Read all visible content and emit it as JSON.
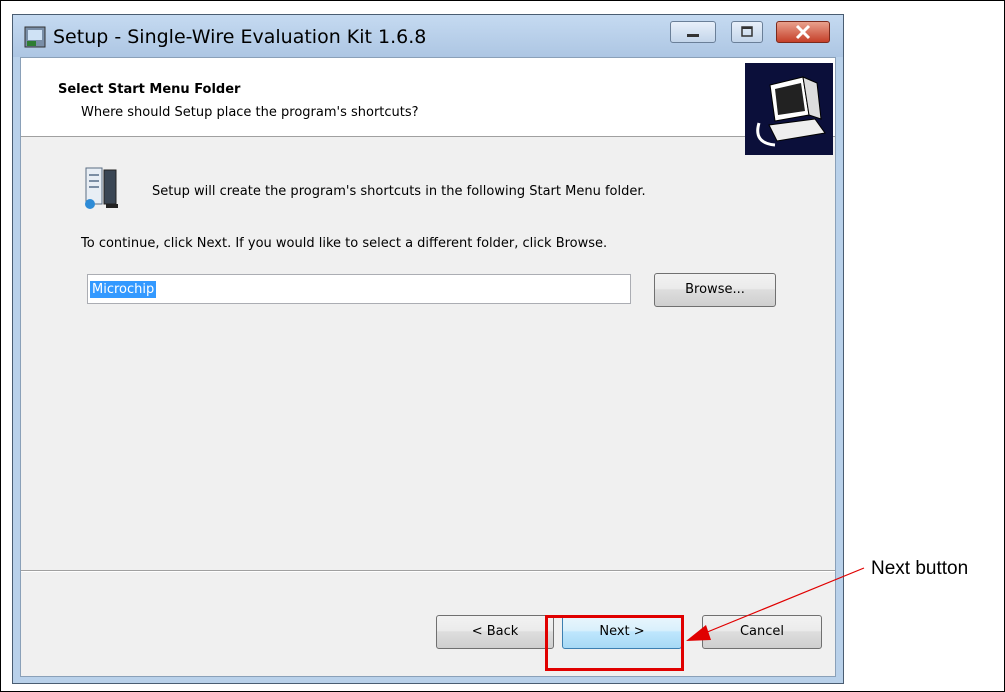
{
  "window": {
    "title": "Setup - Single-Wire Evaluation Kit 1.6.8",
    "buttons": {
      "minimize_icon": "minimize-icon",
      "maximize_icon": "maximize-icon",
      "close_icon": "close-icon"
    }
  },
  "header": {
    "title": "Select Start Menu Folder",
    "subtitle": "Where should Setup place the program's shortcuts?"
  },
  "body": {
    "intro": "Setup will create the program's shortcuts in the following Start Menu folder.",
    "continue_text": "To continue, click Next. If you would like to select a different folder, click Browse.",
    "folder_value": "Microchip",
    "browse_label": "Browse..."
  },
  "footer": {
    "back_label": "< Back",
    "next_label": "Next >",
    "cancel_label": "Cancel"
  },
  "annotation": {
    "label": "Next button",
    "color": "#e00000"
  }
}
